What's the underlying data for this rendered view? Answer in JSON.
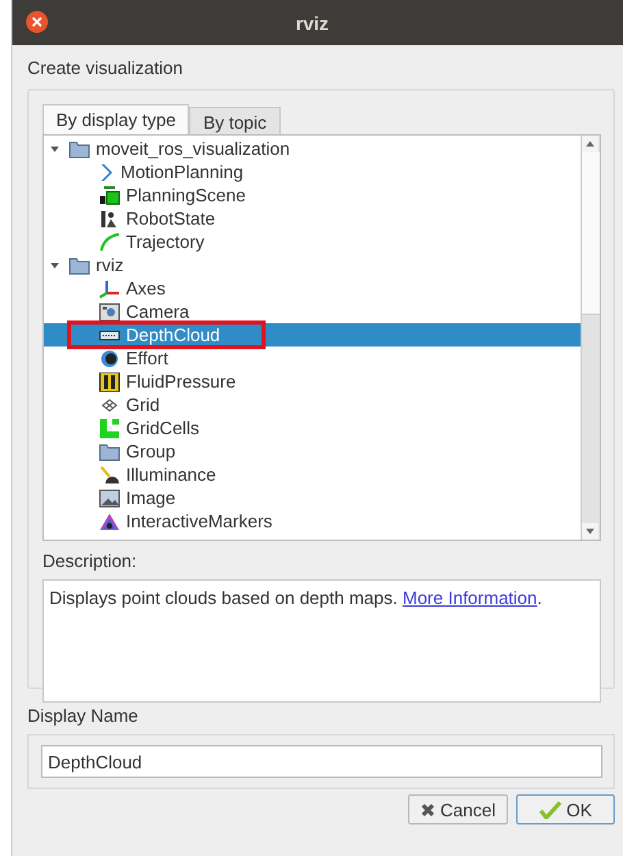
{
  "window": {
    "title": "rviz"
  },
  "heading": "Create visualization",
  "tabs": [
    {
      "label": "By display type",
      "selected": true
    },
    {
      "label": "By topic",
      "selected": false
    }
  ],
  "tree": [
    {
      "label": "moveit_ros_visualization",
      "kind": "folder",
      "expanded": true,
      "selected": false,
      "highlighted": false,
      "children": [
        {
          "label": "MotionPlanning",
          "kind": "chevron",
          "selected": false,
          "highlighted": false
        },
        {
          "label": "PlanningScene",
          "kind": "blocks",
          "selected": false,
          "highlighted": false
        },
        {
          "label": "RobotState",
          "kind": "robot",
          "selected": false,
          "highlighted": false
        },
        {
          "label": "Trajectory",
          "kind": "arc",
          "selected": false,
          "highlighted": false
        }
      ]
    },
    {
      "label": "rviz",
      "kind": "folder",
      "expanded": true,
      "selected": false,
      "highlighted": false,
      "children": [
        {
          "label": "Axes",
          "kind": "axes",
          "selected": false,
          "highlighted": false
        },
        {
          "label": "Camera",
          "kind": "camera",
          "selected": false,
          "highlighted": false
        },
        {
          "label": "DepthCloud",
          "kind": "cloud",
          "selected": true,
          "highlighted": true
        },
        {
          "label": "Effort",
          "kind": "effort",
          "selected": false,
          "highlighted": false
        },
        {
          "label": "FluidPressure",
          "kind": "gauge",
          "selected": false,
          "highlighted": false
        },
        {
          "label": "Grid",
          "kind": "grid",
          "selected": false,
          "highlighted": false
        },
        {
          "label": "GridCells",
          "kind": "cells",
          "selected": false,
          "highlighted": false
        },
        {
          "label": "Group",
          "kind": "folder",
          "selected": false,
          "highlighted": false
        },
        {
          "label": "Illuminance",
          "kind": "lamp",
          "selected": false,
          "highlighted": false
        },
        {
          "label": "Image",
          "kind": "image",
          "selected": false,
          "highlighted": false
        },
        {
          "label": "InteractiveMarkers",
          "kind": "markers",
          "selected": false,
          "highlighted": false
        }
      ]
    }
  ],
  "description": {
    "label": "Description:",
    "text": "Displays point clouds based on depth maps.",
    "link": "More Information",
    "after_link": "."
  },
  "display_name": {
    "label": "Display Name",
    "value": "DepthCloud"
  },
  "buttons": [
    {
      "label": "Cancel",
      "kind": "cancel"
    },
    {
      "label": "OK",
      "kind": "ok"
    }
  ]
}
